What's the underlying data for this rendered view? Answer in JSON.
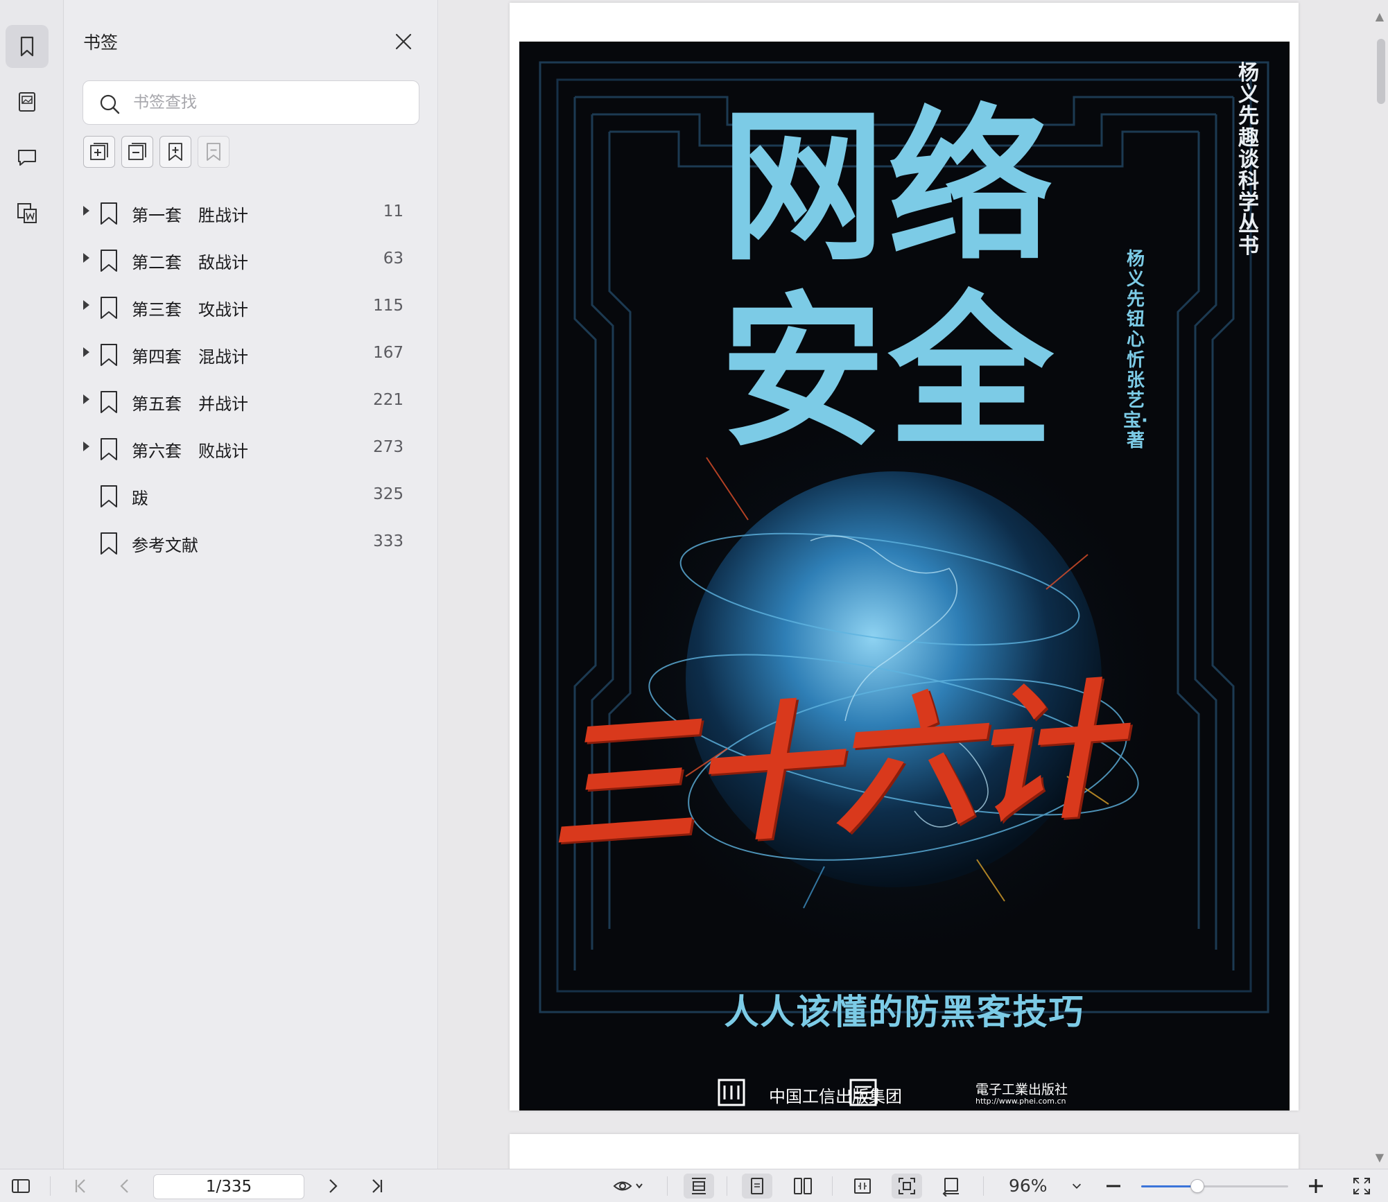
{
  "sidebar_rail": {
    "items": [
      {
        "icon": "bookmark-icon",
        "active": true
      },
      {
        "icon": "thumbnail-icon",
        "active": false
      },
      {
        "icon": "comment-icon",
        "active": false
      },
      {
        "icon": "page-search-icon",
        "active": false
      }
    ]
  },
  "bookmarks_panel": {
    "title": "书签",
    "search_placeholder": "书签查找",
    "toolbar": [
      "expand-all-icon",
      "collapse-all-icon",
      "add-bookmark-icon",
      "remove-bookmark-icon"
    ],
    "items": [
      {
        "label": "第一套　胜战计",
        "page": "11",
        "expandable": true
      },
      {
        "label": "第二套　敌战计",
        "page": "63",
        "expandable": true
      },
      {
        "label": "第三套　攻战计",
        "page": "115",
        "expandable": true
      },
      {
        "label": "第四套　混战计",
        "page": "167",
        "expandable": true
      },
      {
        "label": "第五套　并战计",
        "page": "221",
        "expandable": true
      },
      {
        "label": "第六套　败战计",
        "page": "273",
        "expandable": true
      },
      {
        "label": "跋",
        "page": "325",
        "expandable": false
      },
      {
        "label": "参考文献",
        "page": "333",
        "expandable": false
      }
    ]
  },
  "cover": {
    "title_line1": "网络",
    "title_line2": "安全",
    "series": "杨义先趣谈科学丛书",
    "authors": "杨义先 钮心忻 张艺宝·著",
    "red_title": "三十六计",
    "subtitle": "人人该懂的防黑客技巧",
    "publisher1": "中国工信出版集团",
    "publisher2": "電子工業出版社",
    "publisher2_url": "http://www.phei.com.cn",
    "colors": {
      "title": "#7ccbe6",
      "red": "#d9391c",
      "background": "#06080c"
    }
  },
  "bottom_toolbar": {
    "page_indicator": "1/335",
    "zoom": "96%",
    "zoom_level_fraction": 0.38,
    "accent": "#3b74d9"
  }
}
